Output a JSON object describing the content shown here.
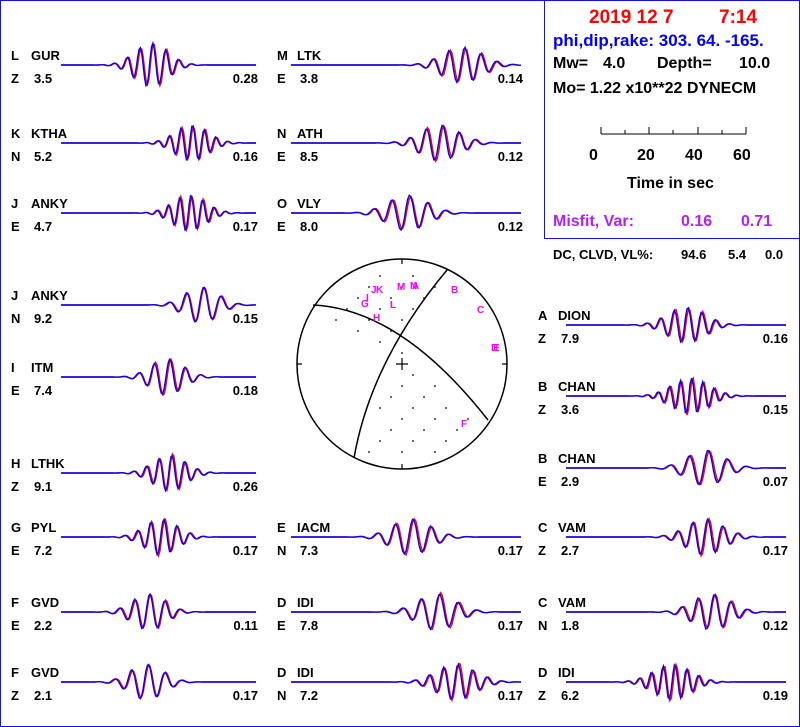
{
  "header": {
    "date": "2019 12  7",
    "time": "7:14",
    "mechanism": "phi,dip,rake: 303. 64. -165.",
    "mw_label": "Mw=",
    "mw": "4.0",
    "depth_label": "Depth=",
    "depth": "10.0",
    "mo": "Mo=  1.22 x10**22 DYNECM",
    "time_ticks": [
      "0",
      "20",
      "40",
      "60"
    ],
    "time_axis_label": "Time  in sec",
    "misfit_label": "Misfit, Var:",
    "misfit": "0.16",
    "var": "0.71",
    "dc_label": "DC, CLVD, VL%:",
    "dc": "94.6",
    "clvd": "5.4",
    "vl": "0.0"
  },
  "colors": {
    "observed": "#ff0000",
    "synthetic": "#0000ff",
    "accent": "#1010ff",
    "misfit": "#b020ff",
    "stations": "#ff00ff"
  },
  "beachball": {
    "station_labels": [
      "A",
      "B",
      "C",
      "D",
      "E",
      "F",
      "G",
      "H",
      "I",
      "J",
      "K",
      "L",
      "M",
      "N"
    ]
  },
  "chart_data": {
    "type": "line",
    "title": "Waveform fit: observed (red) vs synthetic (blue)",
    "xlabel": "Time in sec",
    "xlim": [
      0,
      60
    ],
    "traces": [
      {
        "code": "L",
        "station": "GUR",
        "comp": "Z",
        "left": "3.5",
        "right": "0.28"
      },
      {
        "code": "K",
        "station": "KTHA",
        "comp": "N",
        "left": "5.2",
        "right": "0.16"
      },
      {
        "code": "J",
        "station": "ANKY",
        "comp": "E",
        "left": "4.7",
        "right": "0.17"
      },
      {
        "code": "J",
        "station": "ANKY",
        "comp": "N",
        "left": "9.2",
        "right": "0.15"
      },
      {
        "code": "I",
        "station": "ITM",
        "comp": "E",
        "left": "7.4",
        "right": "0.18"
      },
      {
        "code": "H",
        "station": "LTHK",
        "comp": "Z",
        "left": "9.1",
        "right": "0.26"
      },
      {
        "code": "G",
        "station": "PYL",
        "comp": "E",
        "left": "7.2",
        "right": "0.17"
      },
      {
        "code": "F",
        "station": "GVD",
        "comp": "E",
        "left": "2.2",
        "right": "0.11"
      },
      {
        "code": "F",
        "station": "GVD",
        "comp": "Z",
        "left": "2.1",
        "right": "0.17"
      },
      {
        "code": "M",
        "station": "LTK",
        "comp": "E",
        "left": "3.8",
        "right": "0.14"
      },
      {
        "code": "N",
        "station": "ATH",
        "comp": "E",
        "left": "8.5",
        "right": "0.12"
      },
      {
        "code": "O",
        "station": "VLY",
        "comp": "E",
        "left": "8.0",
        "right": "0.12"
      },
      {
        "code": "E",
        "station": "IACM",
        "comp": "N",
        "left": "7.3",
        "right": "0.17"
      },
      {
        "code": "D",
        "station": "IDI",
        "comp": "E",
        "left": "7.8",
        "right": "0.17"
      },
      {
        "code": "D",
        "station": "IDI",
        "comp": "N",
        "left": "7.2",
        "right": "0.17"
      },
      {
        "code": "A",
        "station": "DION",
        "comp": "Z",
        "left": "7.9",
        "right": "0.16"
      },
      {
        "code": "B",
        "station": "CHAN",
        "comp": "Z",
        "left": "3.6",
        "right": "0.15"
      },
      {
        "code": "B",
        "station": "CHAN",
        "comp": "E",
        "left": "2.9",
        "right": "0.07"
      },
      {
        "code": "C",
        "station": "VAM",
        "comp": "Z",
        "left": "2.7",
        "right": "0.17"
      },
      {
        "code": "C",
        "station": "VAM",
        "comp": "N",
        "left": "1.8",
        "right": "0.12"
      },
      {
        "code": "D",
        "station": "IDI",
        "comp": "Z",
        "left": "6.2",
        "right": "0.19"
      }
    ]
  }
}
